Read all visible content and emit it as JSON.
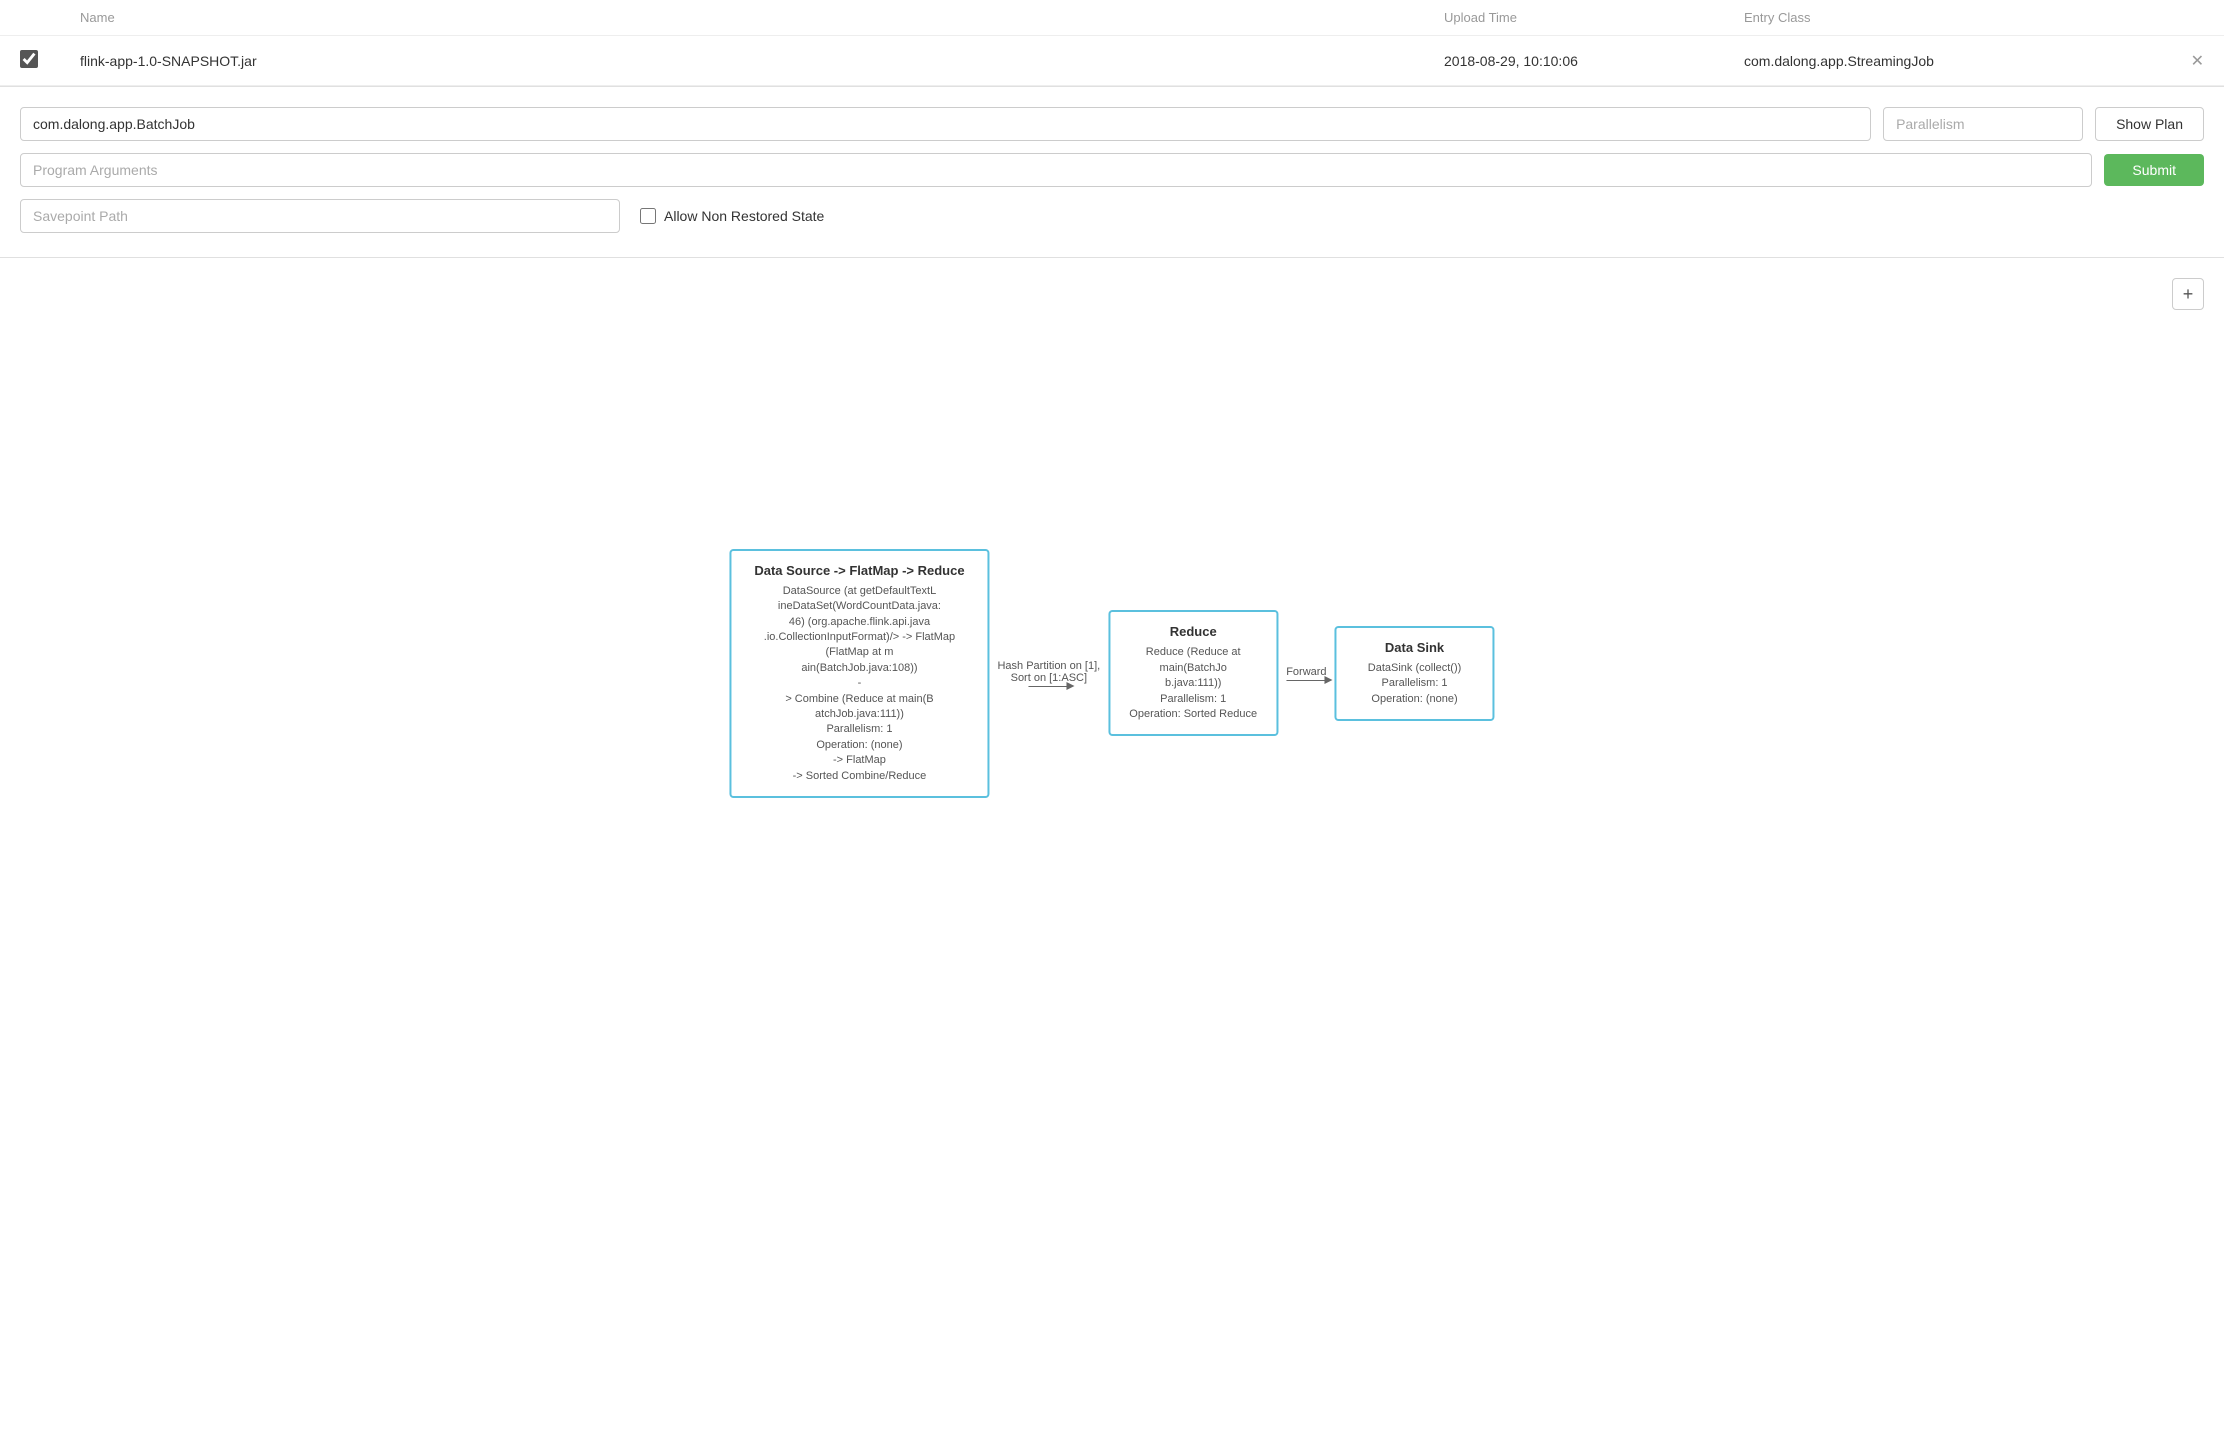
{
  "table": {
    "headers": {
      "name": "Name",
      "upload_time": "Upload Time",
      "entry_class": "Entry Class"
    },
    "rows": [
      {
        "checked": true,
        "filename": "flink-app-1.0-SNAPSHOT.jar",
        "upload_time": "2018-08-29, 10:10:06",
        "entry_class": "com.dalong.app.StreamingJob"
      }
    ]
  },
  "form": {
    "entry_class_value": "com.dalong.app.BatchJob",
    "entry_class_placeholder": "",
    "parallelism_placeholder": "Parallelism",
    "program_args_placeholder": "Program Arguments",
    "savepoint_path_placeholder": "Savepoint Path",
    "allow_non_restored_label": "Allow Non Restored State",
    "show_plan_label": "Show Plan",
    "submit_label": "Submit"
  },
  "plan": {
    "zoom_label": "+",
    "nodes": [
      {
        "id": "node1",
        "title": "Data Source -> FlatMap -> Reduce",
        "details": "DataSource (at getDefaultTextL\nineDataSet(WordCountData.java:\n46) (org.apache.flink.api.java\n.io.CollectionInputFormat)/> -> FlatMap (FlatMap at m\nain(BatchJob.java:108))\n-\n> Combine (Reduce at main(B\natchJob.java:111))\nParallelism: 1\nOperation: (none)\n-> FlatMap\n-> Sorted Combine/Reduce",
        "size": "large"
      },
      {
        "id": "arrow1",
        "label": "Hash Partition on [1],\nSort on [1:ASC]"
      },
      {
        "id": "node2",
        "title": "Reduce",
        "details": "Reduce (Reduce at main(BatchJo\nb.java:111))\nParallelism: 1\nOperation: Sorted Reduce",
        "size": "medium"
      },
      {
        "id": "arrow2",
        "label": "Forward"
      },
      {
        "id": "node3",
        "title": "Data Sink",
        "details": "DataSink (collect())\nParallelism: 1\nOperation: (none)",
        "size": "small"
      }
    ]
  }
}
